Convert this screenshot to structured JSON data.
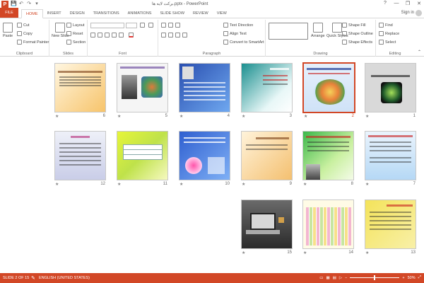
{
  "window": {
    "title": "برکت لایه ها.pptx - PowerPoint",
    "app_logo": "P",
    "controls": [
      "?",
      "—",
      "❐",
      "✕"
    ]
  },
  "qat": [
    "💾",
    "↶",
    "↷",
    "▾"
  ],
  "tabs": [
    {
      "label": "FILE"
    },
    {
      "label": "HOME"
    },
    {
      "label": "INSERT"
    },
    {
      "label": "DESIGN"
    },
    {
      "label": "TRANSITIONS"
    },
    {
      "label": "ANIMATIONS"
    },
    {
      "label": "SLIDE SHOW"
    },
    {
      "label": "REVIEW"
    },
    {
      "label": "VIEW"
    }
  ],
  "signin": "Sign in",
  "ribbon": {
    "clipboard": {
      "label": "Clipboard",
      "paste": "Paste",
      "cut": "Cut",
      "copy": "Copy",
      "format_painter": "Format Painter"
    },
    "slides": {
      "label": "Slides",
      "new_slide": "New Slide",
      "layout": "Layout",
      "reset": "Reset",
      "section": "Section"
    },
    "font": {
      "label": "Font"
    },
    "paragraph": {
      "label": "Paragraph",
      "text_direction": "Text Direction",
      "align_text": "Align Text",
      "convert": "Convert to SmartArt"
    },
    "drawing": {
      "label": "Drawing",
      "arrange": "Arrange",
      "quick_styles": "Quick Styles",
      "shape_fill": "Shape Fill",
      "shape_outline": "Shape Outline",
      "shape_effects": "Shape Effects"
    },
    "editing": {
      "label": "Editing",
      "find": "Find",
      "replace": "Replace",
      "select": "Select"
    }
  },
  "slides": [
    {
      "num": "6"
    },
    {
      "num": "5"
    },
    {
      "num": "4"
    },
    {
      "num": "3"
    },
    {
      "num": "2"
    },
    {
      "num": "1"
    },
    {
      "num": "12"
    },
    {
      "num": "11"
    },
    {
      "num": "10"
    },
    {
      "num": "9"
    },
    {
      "num": "8"
    },
    {
      "num": "7"
    },
    {
      "num": "15"
    },
    {
      "num": "14"
    },
    {
      "num": "13"
    }
  ],
  "selected_slide": "2",
  "status": {
    "slide_info": "SLIDE 2 OF 15",
    "language": "ENGLISH (UNITED STATES)",
    "zoom": "50%"
  },
  "colors": {
    "accent": "#d24726"
  }
}
